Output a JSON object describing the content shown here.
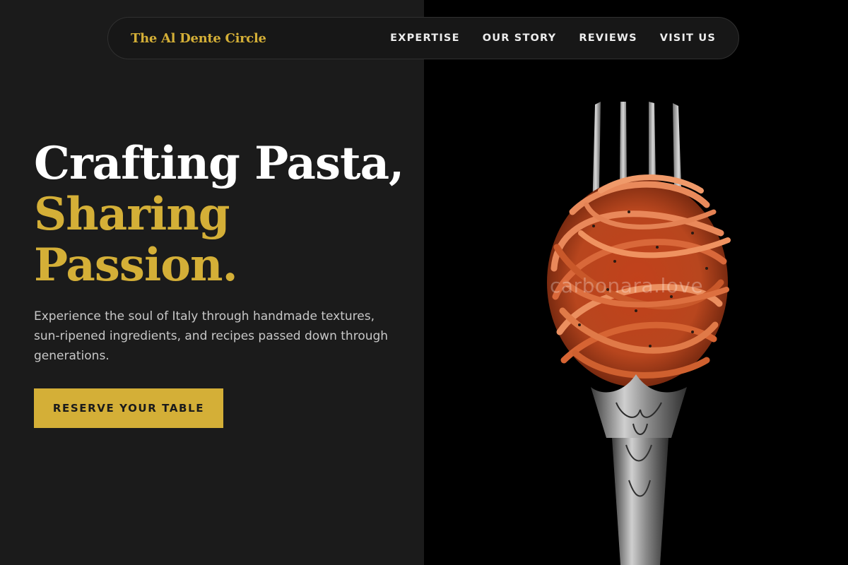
{
  "nav": {
    "brand": "The Al Dente Circle",
    "links": [
      "EXPERTISE",
      "OUR STORY",
      "REVIEWS",
      "VISIT US"
    ]
  },
  "hero": {
    "line1": "Crafting Pasta,",
    "line2": "Sharing",
    "line3": "Passion.",
    "description": "Experience the soul of Italy through handmade textures, sun-ripened ingredients, and recipes passed down through generations.",
    "cta_label": "RESERVE YOUR TABLE"
  },
  "image": {
    "subject": "fork-with-spaghetti-photo",
    "watermark": "carbonara.love"
  },
  "colors": {
    "accent": "#d4af37",
    "background_left": "#1b1b1b",
    "background_right": "#000000",
    "text_light": "#ffffff",
    "text_muted": "#c8c8c8"
  }
}
